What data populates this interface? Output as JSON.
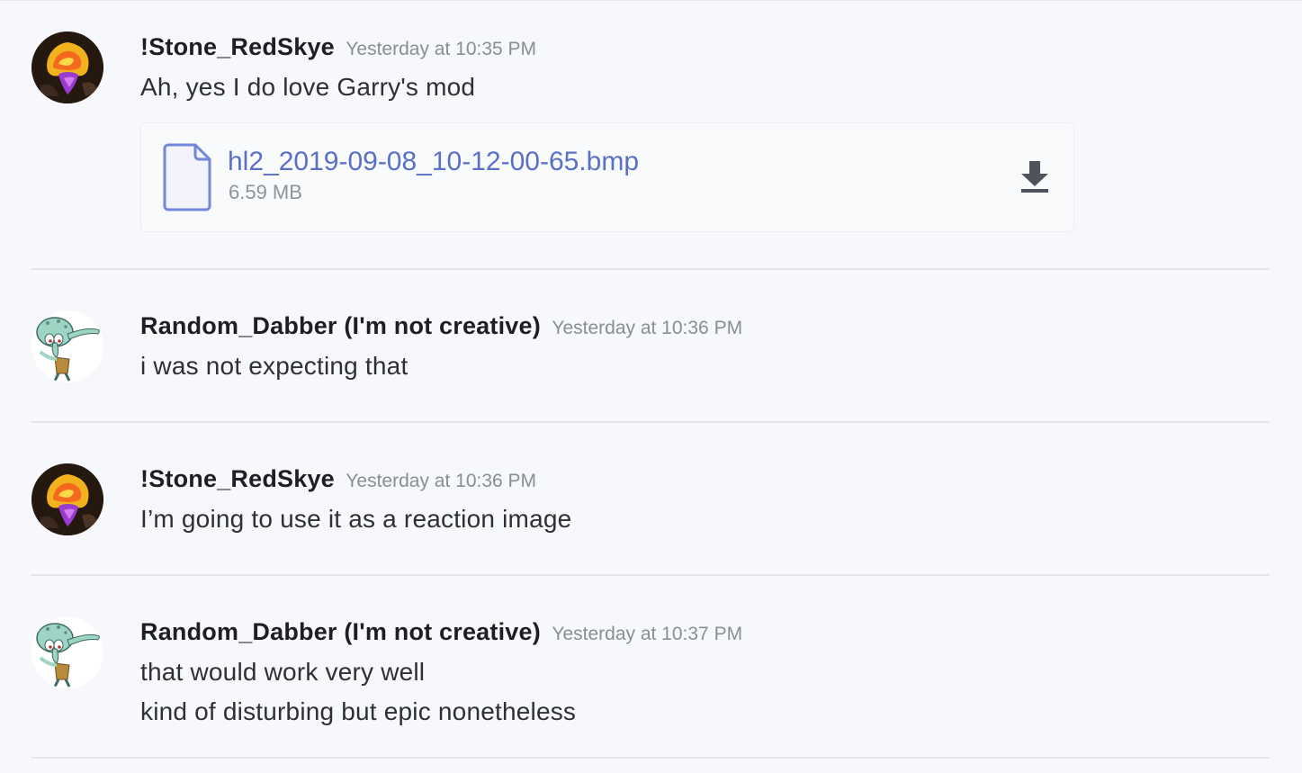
{
  "messages": [
    {
      "username": "!Stone_RedSkye",
      "timestamp": "Yesterday at 10:35 PM",
      "avatar": "flame-avatar",
      "lines": [
        "Ah, yes I do love Garry's mod"
      ],
      "attachment": {
        "filename": "hl2_2019-09-08_10-12-00-65.bmp",
        "size": "6.59 MB",
        "icon": "file-icon",
        "action_icon": "download-icon"
      }
    },
    {
      "username": "Random_Dabber (I'm not creative)",
      "timestamp": "Yesterday at 10:36 PM",
      "avatar": "squidward-dab-avatar",
      "lines": [
        "i was not expecting that"
      ]
    },
    {
      "username": "!Stone_RedSkye",
      "timestamp": "Yesterday at 10:36 PM",
      "avatar": "flame-avatar",
      "lines": [
        "I’m going to use it as a reaction image"
      ]
    },
    {
      "username": "Random_Dabber (I'm not creative)",
      "timestamp": "Yesterday at 10:37 PM",
      "avatar": "squidward-dab-avatar",
      "lines": [
        "that would work very well",
        "kind of disturbing but epic nonetheless"
      ]
    }
  ],
  "colors": {
    "background": "#f6f8fb",
    "username": "#1d1f22",
    "timestamp": "#8a8d92",
    "message_text": "#2e3033",
    "link": "#5a6fc6",
    "file_icon": "#7289da"
  }
}
